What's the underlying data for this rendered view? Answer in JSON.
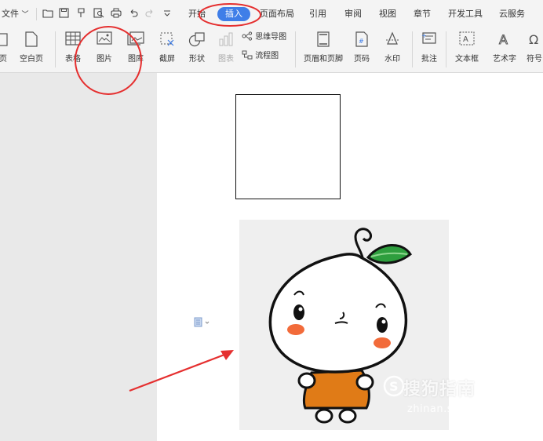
{
  "quick_access": {
    "file_label": "文件"
  },
  "tabs": [
    {
      "label": "开始"
    },
    {
      "label": "插入"
    },
    {
      "label": "页面布局"
    },
    {
      "label": "引用"
    },
    {
      "label": "审阅"
    },
    {
      "label": "视图"
    },
    {
      "label": "章节"
    },
    {
      "label": "开发工具"
    },
    {
      "label": "云服务"
    }
  ],
  "ribbon": {
    "left_cut_label": "页",
    "blank_page": "空白页",
    "table": "表格",
    "picture": "图片",
    "gallery": "图库",
    "screenshot": "截屏",
    "shapes": "形状",
    "chart": "图表",
    "mindmap": "思维导图",
    "flowchart": "流程图",
    "header_footer": "页眉和页脚",
    "page_number": "页码",
    "watermark": "水印",
    "comment": "批注",
    "textbox": "文本框",
    "wordart": "艺术字",
    "symbol": "符号"
  },
  "watermark_text": {
    "title": "搜狗指南",
    "url": "zhinan.sogou.com"
  },
  "colors": {
    "accent": "#3f7ee8",
    "annotation_red": "#e52f2f",
    "leaf_green": "#2e9e3e",
    "body_orange": "#e07b17"
  }
}
